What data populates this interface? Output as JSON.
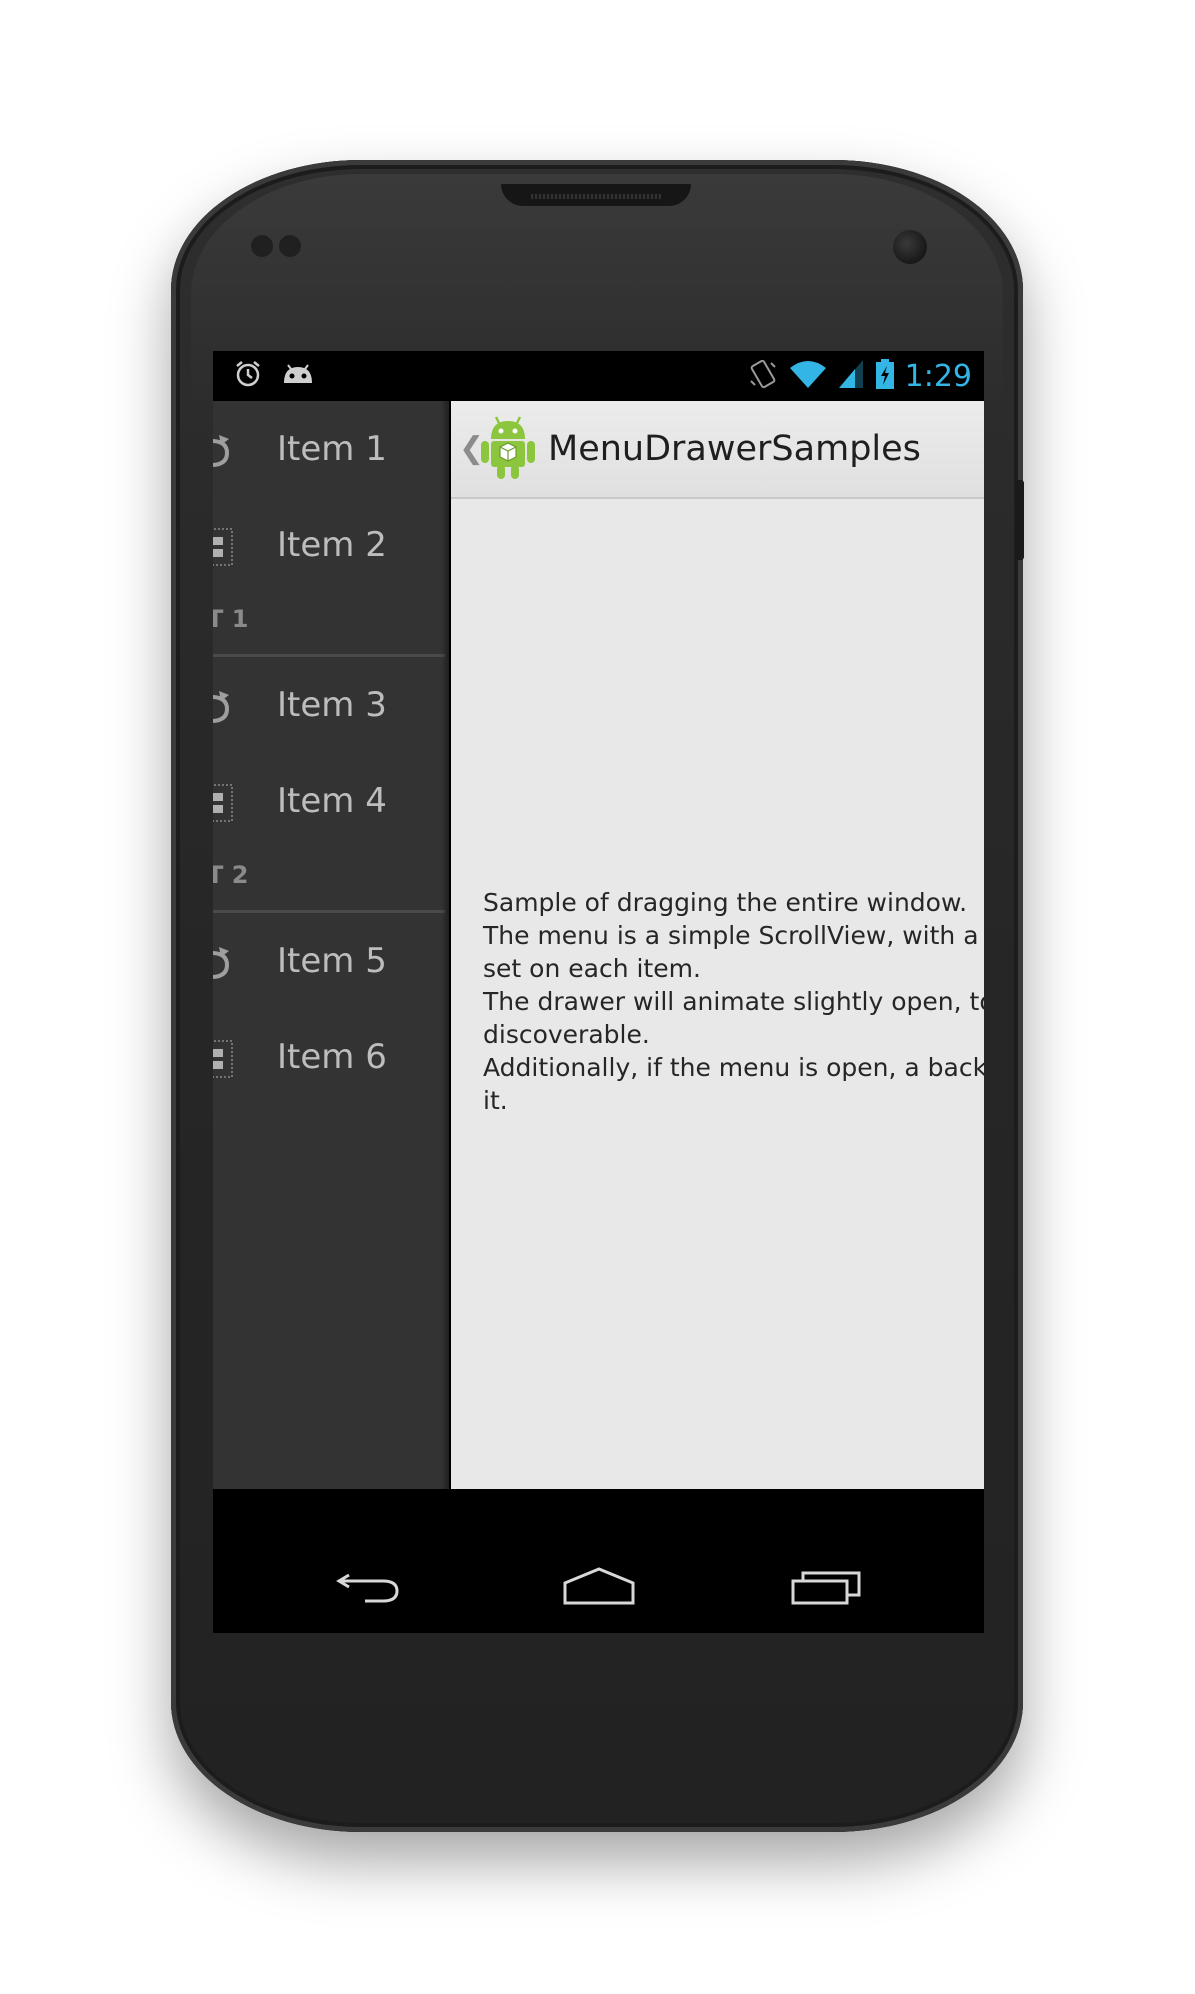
{
  "status_bar": {
    "time": "1:29",
    "left_icons": [
      "alarm-icon",
      "android-debug-icon"
    ],
    "right_icons": [
      "vibrate-icon",
      "wifi-icon",
      "signal-icon",
      "battery-charging-icon"
    ],
    "accent_color": "#33b5e5"
  },
  "drawer": {
    "sections": [
      {
        "type": "item",
        "label": "Item 1",
        "icon": "refresh-icon"
      },
      {
        "type": "item",
        "label": "Item 2",
        "icon": "grid-icon"
      },
      {
        "type": "header",
        "label": "T 1"
      },
      {
        "type": "item",
        "label": "Item 3",
        "icon": "refresh-icon"
      },
      {
        "type": "item",
        "label": "Item 4",
        "icon": "grid-icon"
      },
      {
        "type": "header",
        "label": "T 2"
      },
      {
        "type": "item",
        "label": "Item 5",
        "icon": "refresh-icon"
      },
      {
        "type": "item",
        "label": "Item 6",
        "icon": "grid-icon"
      }
    ]
  },
  "action_bar": {
    "title": "MenuDrawerSamples",
    "up_caret": "❮",
    "app_icon": "android-app-icon"
  },
  "content": {
    "lines": [
      "Sample of dragging the entire window.",
      "The menu is a simple ScrollView, with a",
      "set on each item.",
      "The drawer will animate slightly open, to",
      "discoverable.",
      "Additionally, if the menu is open, a back",
      "it."
    ]
  },
  "nav_bar": {
    "buttons": [
      "back-icon",
      "home-icon",
      "recents-icon"
    ]
  }
}
